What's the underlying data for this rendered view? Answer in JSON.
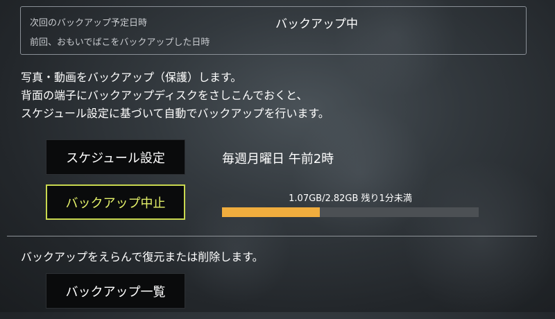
{
  "status": {
    "next_backup_label": "次回のバックアップ予定日時",
    "last_backup_label": "前回、おもいでばこをバックアップした日時",
    "state_text": "バックアップ中"
  },
  "description": {
    "lines": [
      "写真・動画をバックアップ（保護）します。",
      "背面の端子にバックアップディスクをさしこんでおくと、",
      "スケジュール設定に基づいて自動でバックアップを行います。"
    ]
  },
  "schedule": {
    "button_label": "スケジュール設定",
    "value": "毎週月曜日 午前2時"
  },
  "progress": {
    "button_label": "バックアップ中止",
    "text": "1.07GB/2.82GB 残り1分未満",
    "fraction": 0.38,
    "bar_color": "#f0ad3e",
    "active_border_color": "#c9d84f"
  },
  "restore": {
    "description": "バックアップをえらんで復元または削除します。",
    "button_label": "バックアップ一覧"
  }
}
